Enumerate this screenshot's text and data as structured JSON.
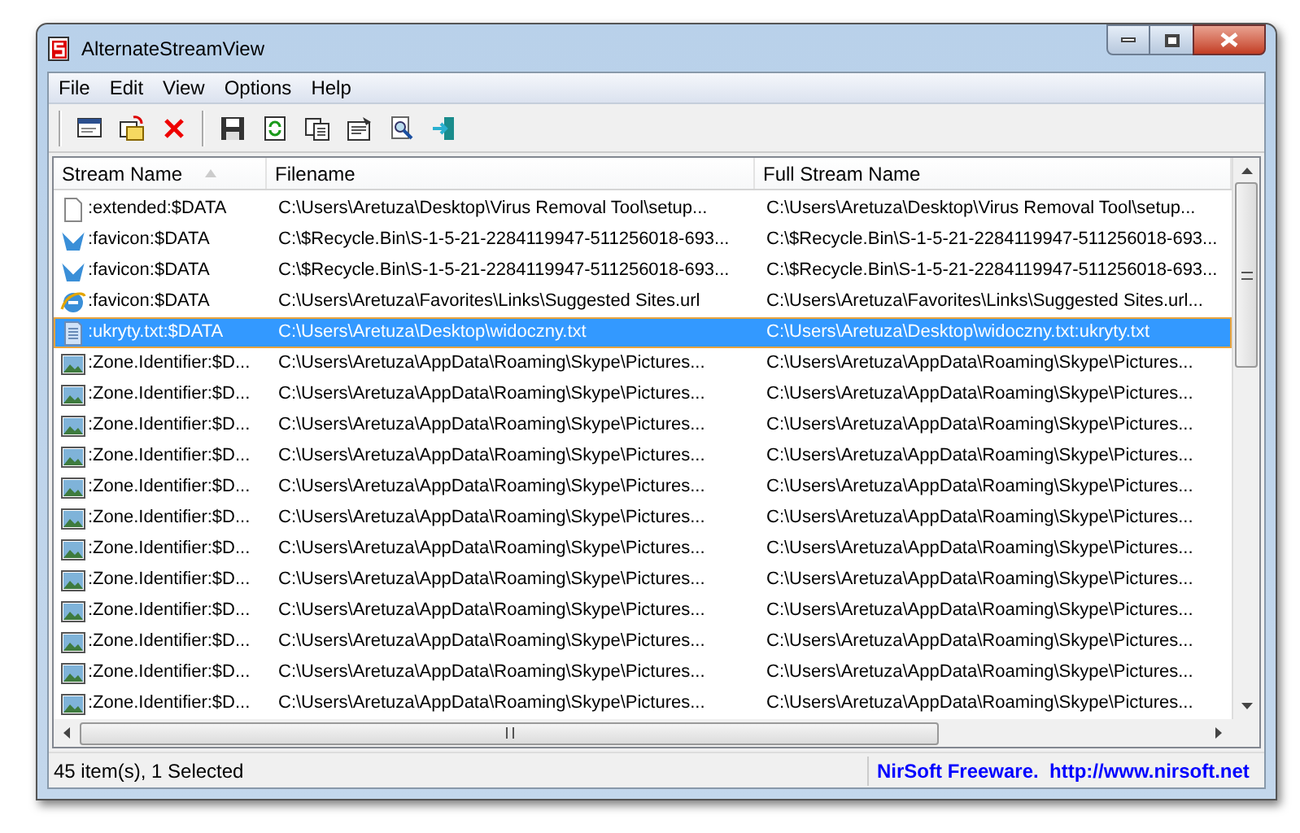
{
  "window": {
    "title": "AlternateStreamView"
  },
  "menu": [
    "File",
    "Edit",
    "View",
    "Options",
    "Help"
  ],
  "columns": [
    {
      "label": "Stream Name",
      "sorted": true
    },
    {
      "label": "Filename",
      "sorted": false
    },
    {
      "label": "Full Stream Name",
      "sorted": false
    }
  ],
  "rows": [
    {
      "kind": "file",
      "stream_name": ":extended:$DATA",
      "filename": "C:\\Users\\Aretuza\\Desktop\\Virus Removal Tool\\setup...",
      "full_stream_name": "C:\\Users\\Aretuza\\Desktop\\Virus Removal Tool\\setup...",
      "selected": false
    },
    {
      "kind": "favicon",
      "stream_name": ":favicon:$DATA",
      "filename": "C:\\$Recycle.Bin\\S-1-5-21-2284119947-511256018-693...",
      "full_stream_name": "C:\\$Recycle.Bin\\S-1-5-21-2284119947-511256018-693...",
      "selected": false
    },
    {
      "kind": "favicon",
      "stream_name": ":favicon:$DATA",
      "filename": "C:\\$Recycle.Bin\\S-1-5-21-2284119947-511256018-693...",
      "full_stream_name": "C:\\$Recycle.Bin\\S-1-5-21-2284119947-511256018-693...",
      "selected": false
    },
    {
      "kind": "browser",
      "stream_name": ":favicon:$DATA",
      "filename": "C:\\Users\\Aretuza\\Favorites\\Links\\Suggested Sites.url",
      "full_stream_name": "C:\\Users\\Aretuza\\Favorites\\Links\\Suggested Sites.url...",
      "selected": false
    },
    {
      "kind": "text",
      "stream_name": ":ukryty.txt:$DATA",
      "filename": "C:\\Users\\Aretuza\\Desktop\\widoczny.txt",
      "full_stream_name": "C:\\Users\\Aretuza\\Desktop\\widoczny.txt:ukryty.txt",
      "selected": true
    },
    {
      "kind": "image",
      "stream_name": ":Zone.Identifier:$D...",
      "filename": "C:\\Users\\Aretuza\\AppData\\Roaming\\Skype\\Pictures...",
      "full_stream_name": "C:\\Users\\Aretuza\\AppData\\Roaming\\Skype\\Pictures...",
      "selected": false
    },
    {
      "kind": "image",
      "stream_name": ":Zone.Identifier:$D...",
      "filename": "C:\\Users\\Aretuza\\AppData\\Roaming\\Skype\\Pictures...",
      "full_stream_name": "C:\\Users\\Aretuza\\AppData\\Roaming\\Skype\\Pictures...",
      "selected": false
    },
    {
      "kind": "image",
      "stream_name": ":Zone.Identifier:$D...",
      "filename": "C:\\Users\\Aretuza\\AppData\\Roaming\\Skype\\Pictures...",
      "full_stream_name": "C:\\Users\\Aretuza\\AppData\\Roaming\\Skype\\Pictures...",
      "selected": false
    },
    {
      "kind": "image",
      "stream_name": ":Zone.Identifier:$D...",
      "filename": "C:\\Users\\Aretuza\\AppData\\Roaming\\Skype\\Pictures...",
      "full_stream_name": "C:\\Users\\Aretuza\\AppData\\Roaming\\Skype\\Pictures...",
      "selected": false
    },
    {
      "kind": "image",
      "stream_name": ":Zone.Identifier:$D...",
      "filename": "C:\\Users\\Aretuza\\AppData\\Roaming\\Skype\\Pictures...",
      "full_stream_name": "C:\\Users\\Aretuza\\AppData\\Roaming\\Skype\\Pictures...",
      "selected": false
    },
    {
      "kind": "image",
      "stream_name": ":Zone.Identifier:$D...",
      "filename": "C:\\Users\\Aretuza\\AppData\\Roaming\\Skype\\Pictures...",
      "full_stream_name": "C:\\Users\\Aretuza\\AppData\\Roaming\\Skype\\Pictures...",
      "selected": false
    },
    {
      "kind": "image",
      "stream_name": ":Zone.Identifier:$D...",
      "filename": "C:\\Users\\Aretuza\\AppData\\Roaming\\Skype\\Pictures...",
      "full_stream_name": "C:\\Users\\Aretuza\\AppData\\Roaming\\Skype\\Pictures...",
      "selected": false
    },
    {
      "kind": "image",
      "stream_name": ":Zone.Identifier:$D...",
      "filename": "C:\\Users\\Aretuza\\AppData\\Roaming\\Skype\\Pictures...",
      "full_stream_name": "C:\\Users\\Aretuza\\AppData\\Roaming\\Skype\\Pictures...",
      "selected": false
    },
    {
      "kind": "image",
      "stream_name": ":Zone.Identifier:$D...",
      "filename": "C:\\Users\\Aretuza\\AppData\\Roaming\\Skype\\Pictures...",
      "full_stream_name": "C:\\Users\\Aretuza\\AppData\\Roaming\\Skype\\Pictures...",
      "selected": false
    },
    {
      "kind": "image",
      "stream_name": ":Zone.Identifier:$D...",
      "filename": "C:\\Users\\Aretuza\\AppData\\Roaming\\Skype\\Pictures...",
      "full_stream_name": "C:\\Users\\Aretuza\\AppData\\Roaming\\Skype\\Pictures...",
      "selected": false
    },
    {
      "kind": "image",
      "stream_name": ":Zone.Identifier:$D...",
      "filename": "C:\\Users\\Aretuza\\AppData\\Roaming\\Skype\\Pictures...",
      "full_stream_name": "C:\\Users\\Aretuza\\AppData\\Roaming\\Skype\\Pictures...",
      "selected": false
    },
    {
      "kind": "image",
      "stream_name": ":Zone.Identifier:$D...",
      "filename": "C:\\Users\\Aretuza\\AppData\\Roaming\\Skype\\Pictures...",
      "full_stream_name": "C:\\Users\\Aretuza\\AppData\\Roaming\\Skype\\Pictures...",
      "selected": false
    }
  ],
  "status_bar": {
    "count": "45 item(s), 1 Selected",
    "credit": "NirSoft Freeware.  http://www.nirsoft.net"
  }
}
